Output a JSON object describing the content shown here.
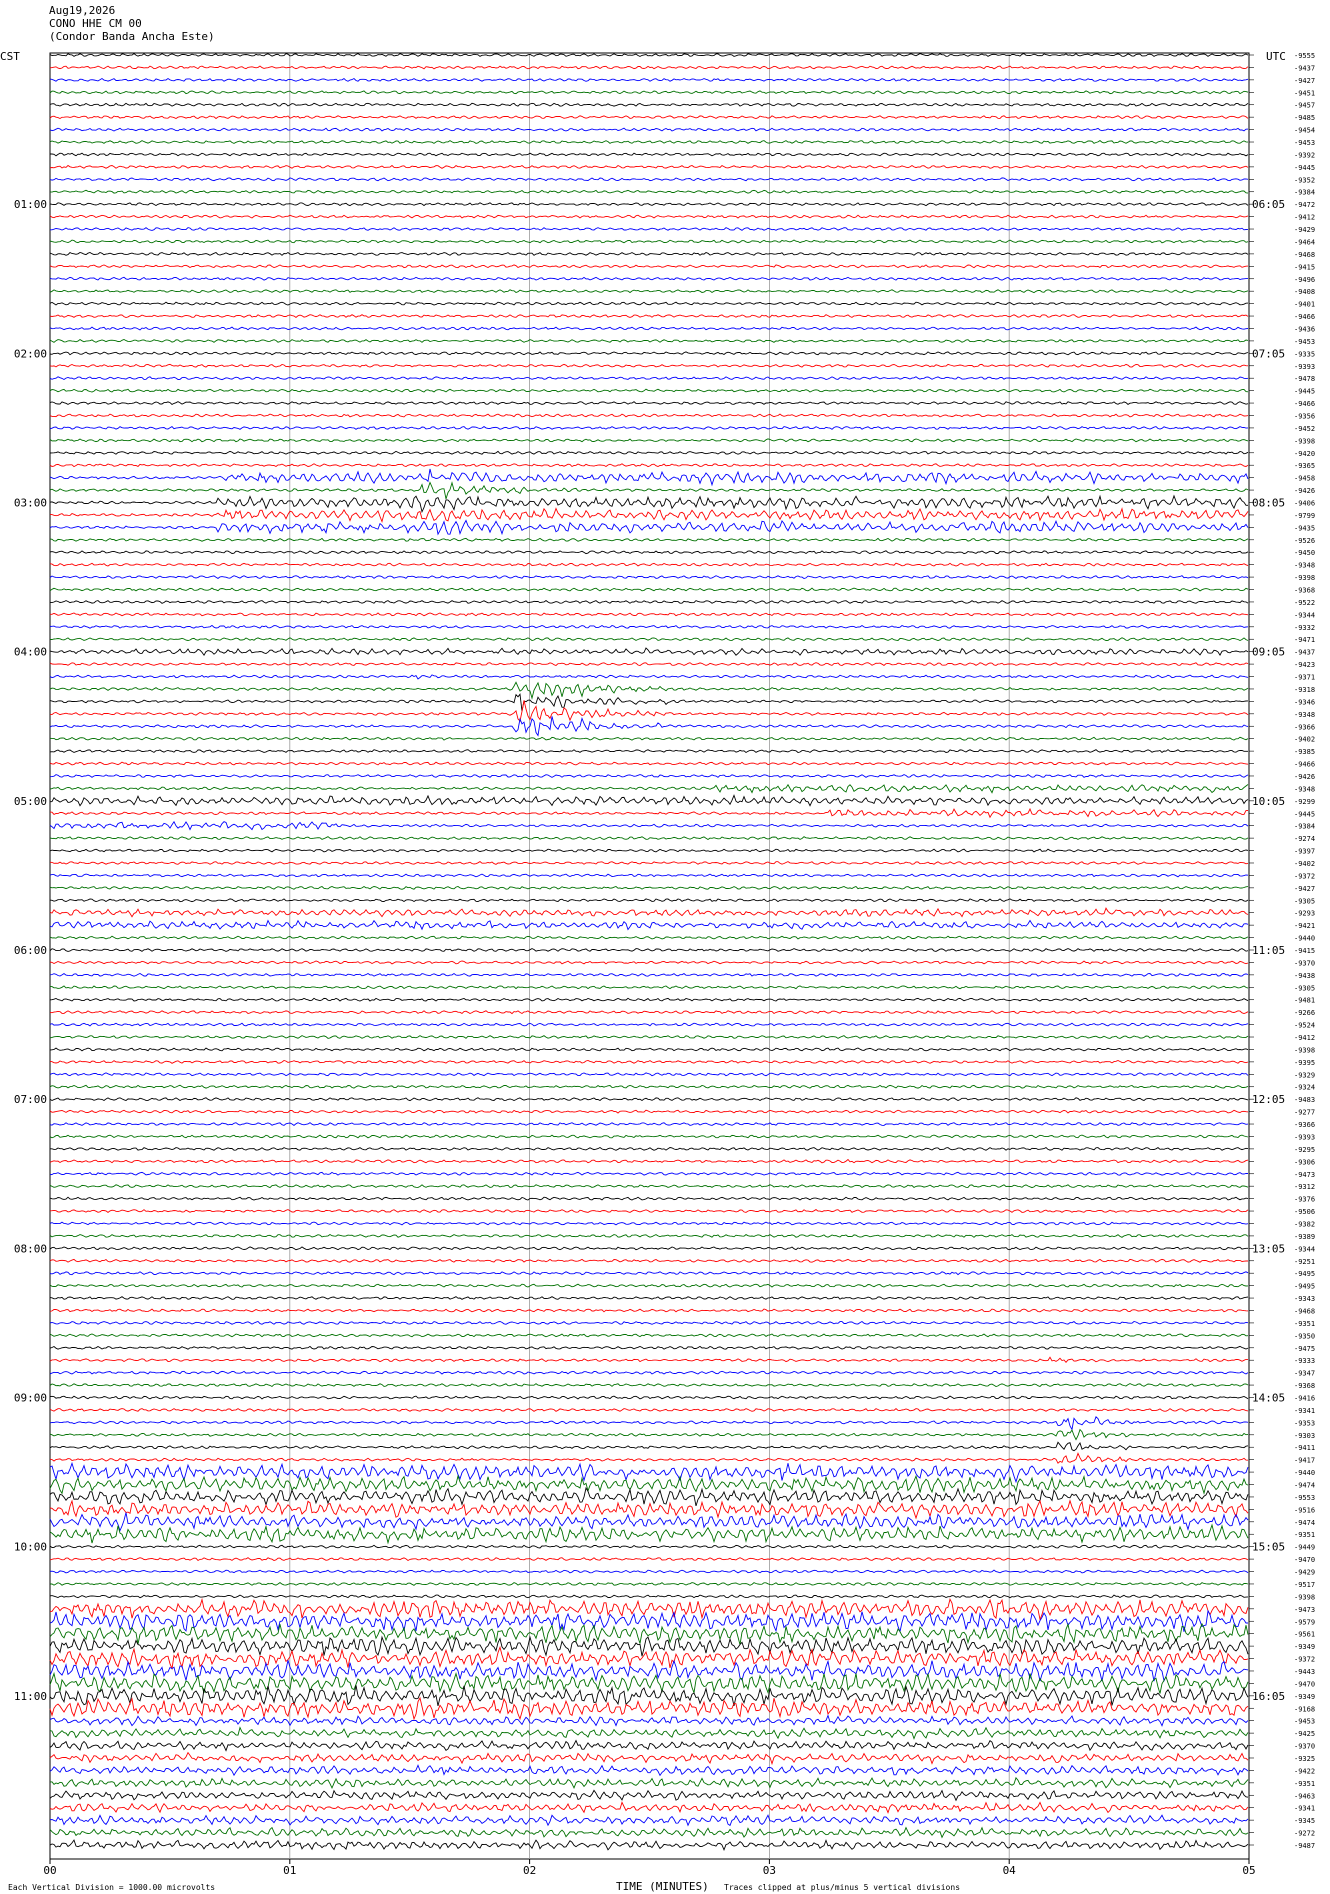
{
  "header": {
    "date": "Aug19,2026",
    "station": "CONO HHE CM 00",
    "name": "(Condor Banda Ancha Este)"
  },
  "timezones": {
    "left": "CST",
    "right": "UTC"
  },
  "footer": {
    "scale_note": "Each Vertical Division = 1000.00 microvolts",
    "clip_note": "Traces clipped at plus/minus 5 vertical divisions",
    "xaxis_title": "TIME (MINUTES)"
  },
  "chart_data": {
    "type": "line",
    "title": "",
    "xlabel": "TIME (MINUTES)",
    "xlim": [
      0,
      5
    ],
    "x_ticks": [
      "00",
      "01",
      "02",
      "03",
      "04",
      "05"
    ],
    "trace_count": 145,
    "trace_color_cycle": [
      "#000000",
      "#ff0000",
      "#0000ff",
      "#007000"
    ],
    "left_time_labels": [
      "01:00",
      "02:00",
      "03:00",
      "04:00",
      "05:00",
      "06:00",
      "07:00",
      "08:00",
      "09:00",
      "10:00",
      "11:00"
    ],
    "right_time_labels": [
      "06:05",
      "07:05",
      "08:05",
      "09:05",
      "10:05",
      "11:05",
      "12:05",
      "13:05",
      "14:05",
      "15:05",
      "16:05"
    ],
    "time_label_trace_index": [
      12,
      24,
      36,
      48,
      60,
      72,
      84,
      96,
      108,
      120,
      132
    ],
    "trace_offsets": [
      "-9555",
      "-9437",
      "-9427",
      "-9451",
      "-9457",
      "-9485",
      "-9454",
      "-9453",
      "-9392",
      "-9445",
      "-9352",
      "-9384",
      "-9472",
      "-9412",
      "-9429",
      "-9464",
      "-9468",
      "-9415",
      "-9496",
      "-9408",
      "-9401",
      "-9466",
      "-9436",
      "-9453",
      "-9335",
      "-9393",
      "-9478",
      "-9445",
      "-9466",
      "-9356",
      "-9452",
      "-9398",
      "-9420",
      "-9365",
      "-9458",
      "-9426",
      "-9406",
      "-9799",
      "-9435",
      "-9526",
      "-9450",
      "-9348",
      "-9398",
      "-9368",
      "-9522",
      "-9344",
      "-9332",
      "-9471",
      "-9437",
      "-9423",
      "-9371",
      "-9318",
      "-9346",
      "-9348",
      "-9366",
      "-9402",
      "-9385",
      "-9466",
      "-9426",
      "-9348",
      "-9299",
      "-9445",
      "-9384",
      "-9274",
      "-9397",
      "-9402",
      "-9372",
      "-9427",
      "-9305",
      "-9293",
      "-9421",
      "-9440",
      "-9415",
      "-9370",
      "-9438",
      "-9305",
      "-9481",
      "-9266",
      "-9524",
      "-9412",
      "-9398",
      "-9395",
      "-9329",
      "-9324",
      "-9483",
      "-9277",
      "-9366",
      "-9393",
      "-9295",
      "-9306",
      "-9473",
      "-9312",
      "-9376",
      "-9506",
      "-9382",
      "-9389",
      "-9344",
      "-9251",
      "-9495",
      "-9495",
      "-9343",
      "-9468",
      "-9351",
      "-9350",
      "-9475",
      "-9333",
      "-9347",
      "-9368",
      "-9416",
      "-9341",
      "-9353",
      "-9303",
      "-9411",
      "-9417",
      "-9440",
      "-9474",
      "-9553",
      "-9516",
      "-9474",
      "-9351",
      "-9449",
      "-9470",
      "-9429",
      "-9517",
      "-9398",
      "-9473",
      "-9579",
      "-9561",
      "-9349",
      "-9372",
      "-9443",
      "-9470",
      "-9349",
      "-9168",
      "-9453",
      "-9425",
      "-9370",
      "-9325",
      "-9422",
      "-9351",
      "-9463",
      "-9341",
      "-9345",
      "-9272",
      "-9487"
    ],
    "events": [
      {
        "traces": [
          34,
          36,
          37,
          38
        ],
        "start_min": 0.7,
        "end_min": 5.0,
        "amplitude": 4.5
      },
      {
        "traces": [
          34,
          35,
          36,
          37,
          38
        ],
        "start_min": 1.55,
        "end_min": 2.2,
        "amplitude": 7
      },
      {
        "traces": [
          47
        ],
        "start_min": 0.8,
        "end_min": 1.0,
        "amplitude": 2
      },
      {
        "traces": [
          48
        ],
        "start_min": 0.1,
        "end_min": 5.0,
        "amplitude": 2.5
      },
      {
        "traces": [
          50
        ],
        "start_min": 1.5,
        "end_min": 1.7,
        "amplitude": 5
      },
      {
        "traces": [
          51,
          52,
          53,
          54
        ],
        "start_min": 1.93,
        "end_min": 2.6,
        "amplitude": 9
      },
      {
        "traces": [
          59
        ],
        "start_min": 2.75,
        "end_min": 5.0,
        "amplitude": 3
      },
      {
        "traces": [
          60
        ],
        "start_min": 0.0,
        "end_min": 5.0,
        "amplitude": 3.5
      },
      {
        "traces": [
          61
        ],
        "start_min": 3.2,
        "end_min": 5.0,
        "amplitude": 3
      },
      {
        "traces": [
          62
        ],
        "start_min": 0.0,
        "end_min": 1.2,
        "amplitude": 3
      },
      {
        "traces": [
          69,
          70
        ],
        "start_min": 0.0,
        "end_min": 5.0,
        "amplitude": 3
      },
      {
        "traces": [
          89
        ],
        "start_min": 3.1,
        "end_min": 3.8,
        "amplitude": 2
      },
      {
        "traces": [
          101
        ],
        "start_min": 2.9,
        "end_min": 3.2,
        "amplitude": 2
      },
      {
        "traces": [
          105
        ],
        "start_min": 4.1,
        "end_min": 5.0,
        "amplitude": 2
      },
      {
        "traces": [
          110,
          111,
          112,
          113
        ],
        "start_min": 4.2,
        "end_min": 4.5,
        "amplitude": 8
      },
      {
        "traces": [
          114,
          115,
          116,
          117,
          118,
          119
        ],
        "start_min": 0.0,
        "end_min": 5.0,
        "amplitude": 6
      },
      {
        "traces": [
          125,
          126,
          127,
          128,
          129,
          130,
          131,
          132,
          133
        ],
        "start_min": 0.0,
        "end_min": 5.0,
        "amplitude": 7
      },
      {
        "traces": [
          134,
          135,
          136,
          137,
          138,
          139,
          140,
          141,
          142,
          143,
          144
        ],
        "start_min": 0.0,
        "end_min": 5.0,
        "amplitude": 3.5
      }
    ]
  }
}
